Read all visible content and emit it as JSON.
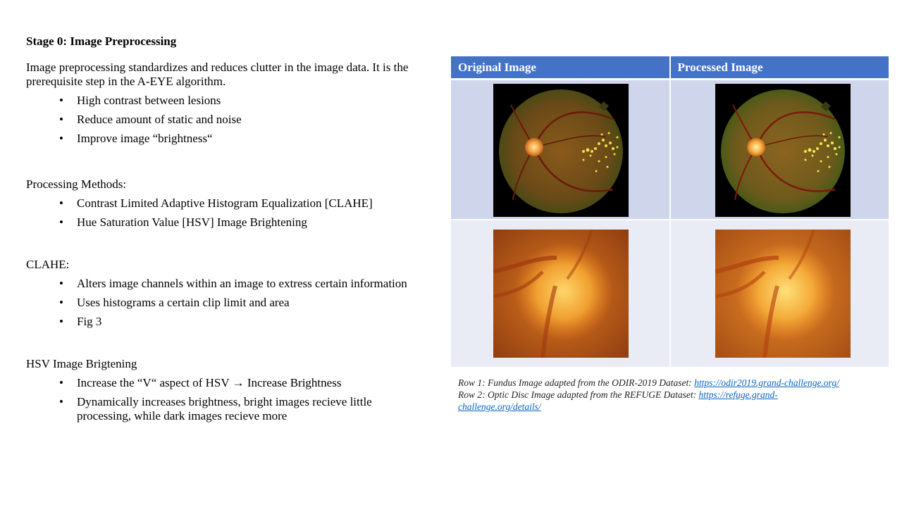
{
  "title": "Stage 0: Image Preprocessing",
  "intro": {
    "text": "Image preprocessing standardizes and reduces clutter in the image data. It is the prerequisite step in the A-EYE algorithm.",
    "bullets": [
      "High contrast between lesions",
      "Reduce amount of static and noise",
      "Improve image “brightness“"
    ]
  },
  "methods": {
    "heading": "Processing Methods:",
    "bullets": [
      "Contrast Limited Adaptive Histogram Equalization [CLAHE]",
      "Hue Saturation Value [HSV] Image Brightening"
    ]
  },
  "clahe": {
    "heading": "CLAHE:",
    "bullets": [
      "Alters image channels within an image to extress certain information",
      "Uses histograms a certain clip limit and area",
      "Fig 3"
    ]
  },
  "hsv": {
    "heading": "HSV Image Brigtening",
    "bullets": [
      "Increase the “V“ aspect of HSV → Increase Brightness",
      "Dynamically increases brightness, bright images recieve little processing, while dark images recieve more"
    ]
  },
  "table": {
    "headers": [
      "Original Image",
      "Processed Image"
    ]
  },
  "caption": {
    "row1_text": "Row 1: Fundus Image adapted from the ODIR-2019 Dataset: ",
    "row1_link": "https://odir2019.grand-challenge.org/",
    "row2_text": "Row 2: Optic Disc Image adapted from the REFUGE Dataset: ",
    "row2_link": "https://refuge.grand-challenge.org/details/"
  }
}
